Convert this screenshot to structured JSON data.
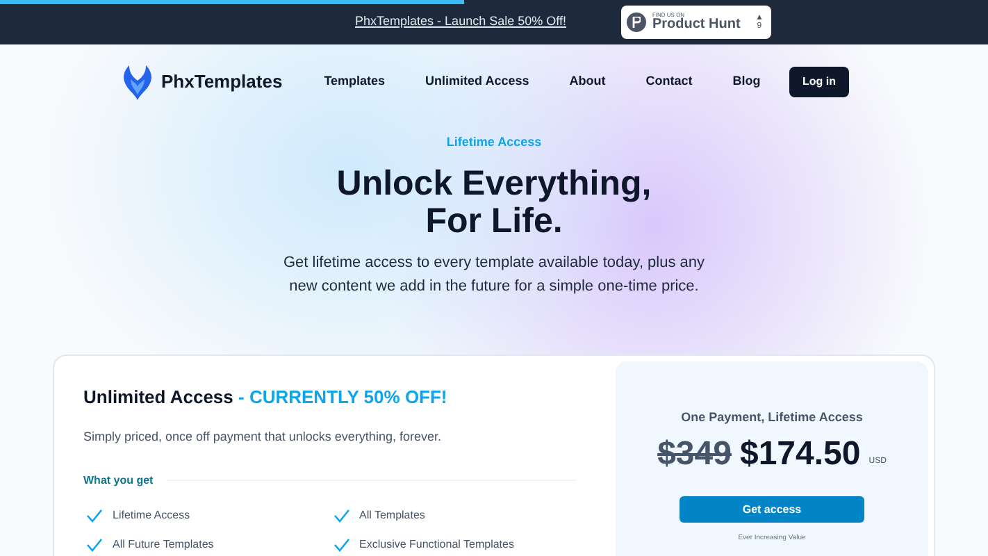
{
  "progress": {
    "level": 0.47
  },
  "announcement": {
    "link": "PhxTemplates - Launch Sale 50% Off!",
    "badge": {
      "small": "FIND US ON",
      "name": "Product Hunt",
      "arrow": "▲",
      "count": "9"
    }
  },
  "nav": {
    "brand": "PhxTemplates",
    "links": [
      "Templates",
      "Unlimited Access",
      "About",
      "Contact",
      "Blog"
    ],
    "login": "Log in"
  },
  "hero": {
    "eyebrow": "Lifetime Access",
    "title_lines": [
      "Unlock Everything,",
      "For Life."
    ],
    "subtitle": "Get lifetime access to every template available today, plus any new content we add in the future for a simple one-time price."
  },
  "pricing": {
    "title": "Unlimited Access",
    "highlight": " - CURRENTLY 50% OFF!",
    "description": "Simply priced, once off payment that unlocks everything, forever.",
    "features_heading": "What you get",
    "features": [
      "Lifetime Access",
      "All Templates",
      "All Future Templates",
      "Exclusive Functional Templates"
    ],
    "panel": {
      "heading": "One Payment, Lifetime Access",
      "old_price": "$349",
      "price": "$174.50",
      "currency": "USD",
      "button": "Get access",
      "note": "Ever Increasing Value"
    }
  }
}
